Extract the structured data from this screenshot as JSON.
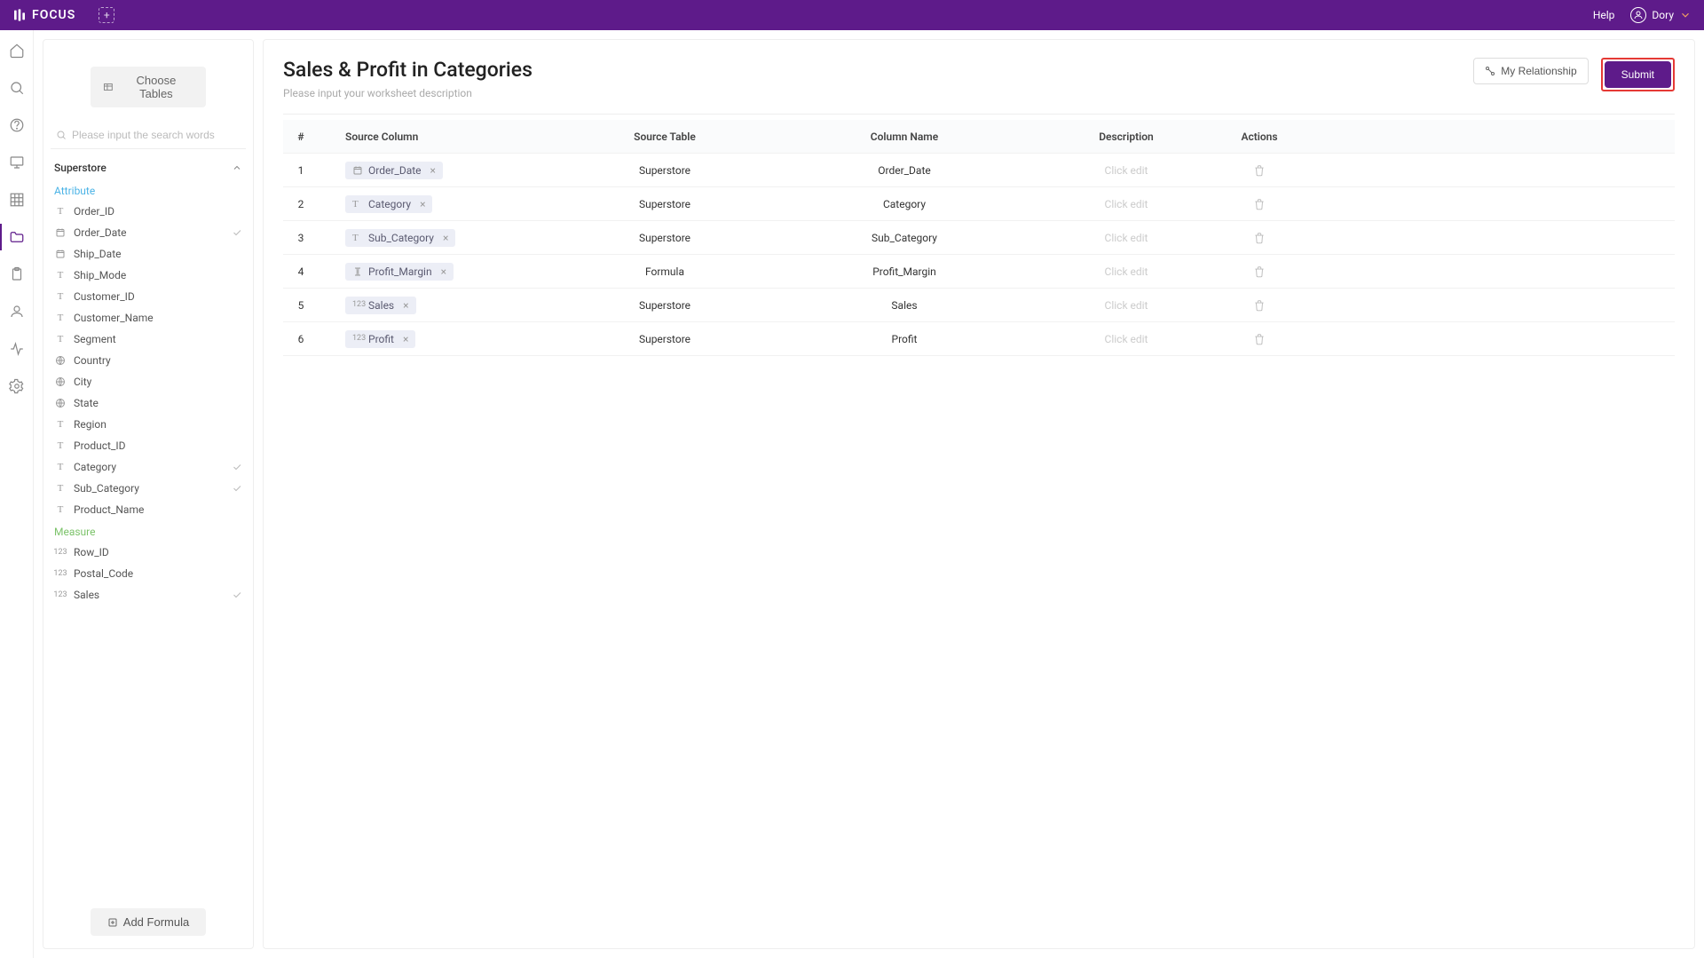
{
  "topbar": {
    "brand": "FOCUS",
    "help": "Help",
    "username": "Dory"
  },
  "rail": {
    "items": [
      {
        "name": "home-icon"
      },
      {
        "name": "search-icon"
      },
      {
        "name": "help-circle-icon"
      },
      {
        "name": "presentation-icon"
      },
      {
        "name": "grid-icon"
      },
      {
        "name": "folder-icon",
        "active": true
      },
      {
        "name": "clipboard-icon"
      },
      {
        "name": "user-icon"
      },
      {
        "name": "activity-icon"
      },
      {
        "name": "settings-icon"
      }
    ]
  },
  "sidebar": {
    "choose_tables_label": "Choose Tables",
    "search_placeholder": "Please input the search words",
    "table_name": "Superstore",
    "section_attribute": "Attribute",
    "section_measure": "Measure",
    "attributes": [
      {
        "type": "text",
        "label": "Order_ID"
      },
      {
        "type": "date",
        "label": "Order_Date",
        "checked": true
      },
      {
        "type": "date",
        "label": "Ship_Date"
      },
      {
        "type": "text",
        "label": "Ship_Mode"
      },
      {
        "type": "text",
        "label": "Customer_ID"
      },
      {
        "type": "text",
        "label": "Customer_Name"
      },
      {
        "type": "text",
        "label": "Segment"
      },
      {
        "type": "geo",
        "label": "Country"
      },
      {
        "type": "geo",
        "label": "City"
      },
      {
        "type": "geo",
        "label": "State"
      },
      {
        "type": "text",
        "label": "Region"
      },
      {
        "type": "text",
        "label": "Product_ID"
      },
      {
        "type": "text",
        "label": "Category",
        "checked": true
      },
      {
        "type": "text",
        "label": "Sub_Category",
        "checked": true
      },
      {
        "type": "text",
        "label": "Product_Name"
      }
    ],
    "measures": [
      {
        "type": "num",
        "label": "Row_ID"
      },
      {
        "type": "num",
        "label": "Postal_Code"
      },
      {
        "type": "num",
        "label": "Sales",
        "checked": true
      }
    ],
    "add_formula_label": "Add Formula"
  },
  "content": {
    "title": "Sales & Profit in Categories",
    "desc_placeholder": "Please input your worksheet description",
    "my_relationship_label": "My Relationship",
    "submit_label": "Submit",
    "columns": {
      "idx": "#",
      "source_column": "Source Column",
      "source_table": "Source Table",
      "column_name": "Column Name",
      "description": "Description",
      "actions": "Actions"
    },
    "desc_click": "Click edit",
    "rows": [
      {
        "idx": "1",
        "pill_type": "date",
        "pill": "Order_Date",
        "table": "Superstore",
        "name": "Order_Date"
      },
      {
        "idx": "2",
        "pill_type": "text",
        "pill": "Category",
        "table": "Superstore",
        "name": "Category"
      },
      {
        "idx": "3",
        "pill_type": "text",
        "pill": "Sub_Category",
        "table": "Superstore",
        "name": "Sub_Category"
      },
      {
        "idx": "4",
        "pill_type": "formula",
        "pill": "Profit_Margin",
        "table": "Formula",
        "name": "Profit_Margin"
      },
      {
        "idx": "5",
        "pill_type": "num",
        "pill": "Sales",
        "table": "Superstore",
        "name": "Sales"
      },
      {
        "idx": "6",
        "pill_type": "num",
        "pill": "Profit",
        "table": "Superstore",
        "name": "Profit"
      }
    ]
  }
}
